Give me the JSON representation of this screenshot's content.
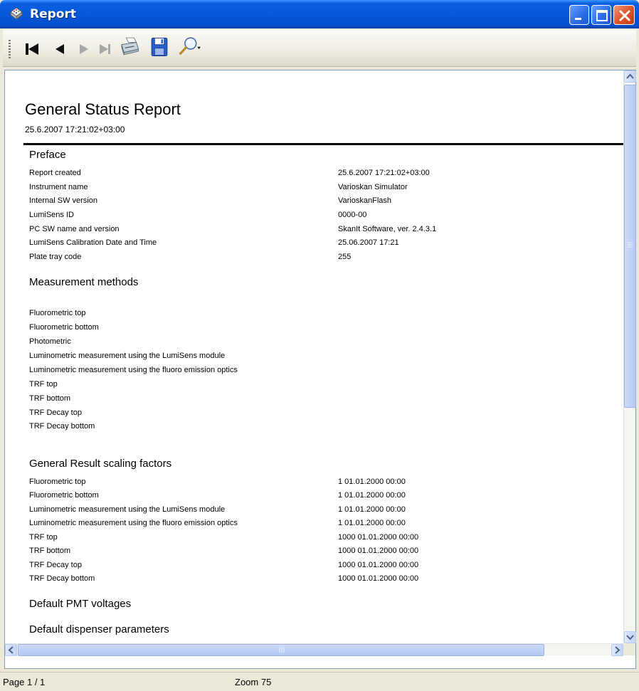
{
  "window": {
    "title": "Report"
  },
  "toolbar": {
    "items": [
      {
        "name": "first-page-icon",
        "enabled": true
      },
      {
        "name": "previous-page-icon",
        "enabled": true
      },
      {
        "name": "next-page-icon",
        "enabled": false
      },
      {
        "name": "last-page-icon",
        "enabled": false
      },
      {
        "name": "print-icon",
        "enabled": true
      },
      {
        "name": "save-icon",
        "enabled": true
      },
      {
        "name": "zoom-icon",
        "enabled": true
      }
    ]
  },
  "report": {
    "title": "General Status Report",
    "date": "25.6.2007 17:21:02+03:00",
    "preface": {
      "heading": "Preface",
      "rows": [
        {
          "label": "Report created",
          "value": "25.6.2007 17:21:02+03:00"
        },
        {
          "label": "Instrument name",
          "value": "Varioskan Simulator"
        },
        {
          "label": "Internal SW version",
          "value": "VarioskanFlash"
        },
        {
          "label": "LumiSens ID",
          "value": "0000-00"
        },
        {
          "label": "PC SW name and version",
          "value": "SkanIt Software, ver. 2.4.3.1"
        },
        {
          "label": "LumiSens Calibration Date and Time",
          "value": "25.06.2007 17:21"
        },
        {
          "label": "Plate tray code",
          "value": "255"
        }
      ]
    },
    "methods": {
      "heading": "Measurement methods",
      "items": [
        "Fluorometric top",
        "Fluorometric bottom",
        "Photometric",
        "Luminometric measurement using the LumiSens module",
        "Luminometric measurement using the fluoro emission optics",
        "TRF top",
        "TRF bottom",
        "TRF Decay top",
        "TRF Decay bottom"
      ]
    },
    "scaling": {
      "heading": "General Result scaling factors",
      "rows": [
        {
          "label": "Fluorometric top",
          "value": "1  01.01.2000 00:00"
        },
        {
          "label": "Fluorometric bottom",
          "value": "1  01.01.2000 00:00"
        },
        {
          "label": "Luminometric measurement using the LumiSens module",
          "value": "1  01.01.2000 00:00"
        },
        {
          "label": "Luminometric measurement using the fluoro emission optics",
          "value": "1  01.01.2000 00:00"
        },
        {
          "label": "TRF top",
          "value": "1000  01.01.2000 00:00"
        },
        {
          "label": "TRF bottom",
          "value": "1000  01.01.2000 00:00"
        },
        {
          "label": "TRF Decay top",
          "value": "1000  01.01.2000 00:00"
        },
        {
          "label": "TRF Decay bottom",
          "value": "1000  01.01.2000 00:00"
        }
      ]
    },
    "pmt_heading": "Default PMT voltages",
    "dispenser_heading": "Default dispenser parameters"
  },
  "status": {
    "page": "Page 1 / 1",
    "zoom": "Zoom 75"
  }
}
